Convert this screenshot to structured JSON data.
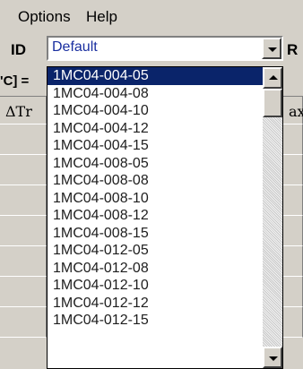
{
  "menu": {
    "options": "Options",
    "help": "Help"
  },
  "id_row": {
    "label": "ID",
    "value": "Default",
    "right_label": "R"
  },
  "background": {
    "formula_fragment": "'C] =",
    "header_left": "ΔTr",
    "header_right": "ax"
  },
  "dropdown": {
    "selected_index": 0,
    "items": [
      "1MC04-004-05",
      "1MC04-004-08",
      "1MC04-004-10",
      "1MC04-004-12",
      "1MC04-004-15",
      "1MC04-008-05",
      "1MC04-008-08",
      "1MC04-008-10",
      "1MC04-008-12",
      "1MC04-008-15",
      "1MC04-012-05",
      "1MC04-012-08",
      "1MC04-012-10",
      "1MC04-012-12",
      "1MC04-012-15"
    ]
  },
  "colors": {
    "selection": "#0a246a",
    "face": "#d4d0c8",
    "combo_text": "#1a2fa0"
  }
}
